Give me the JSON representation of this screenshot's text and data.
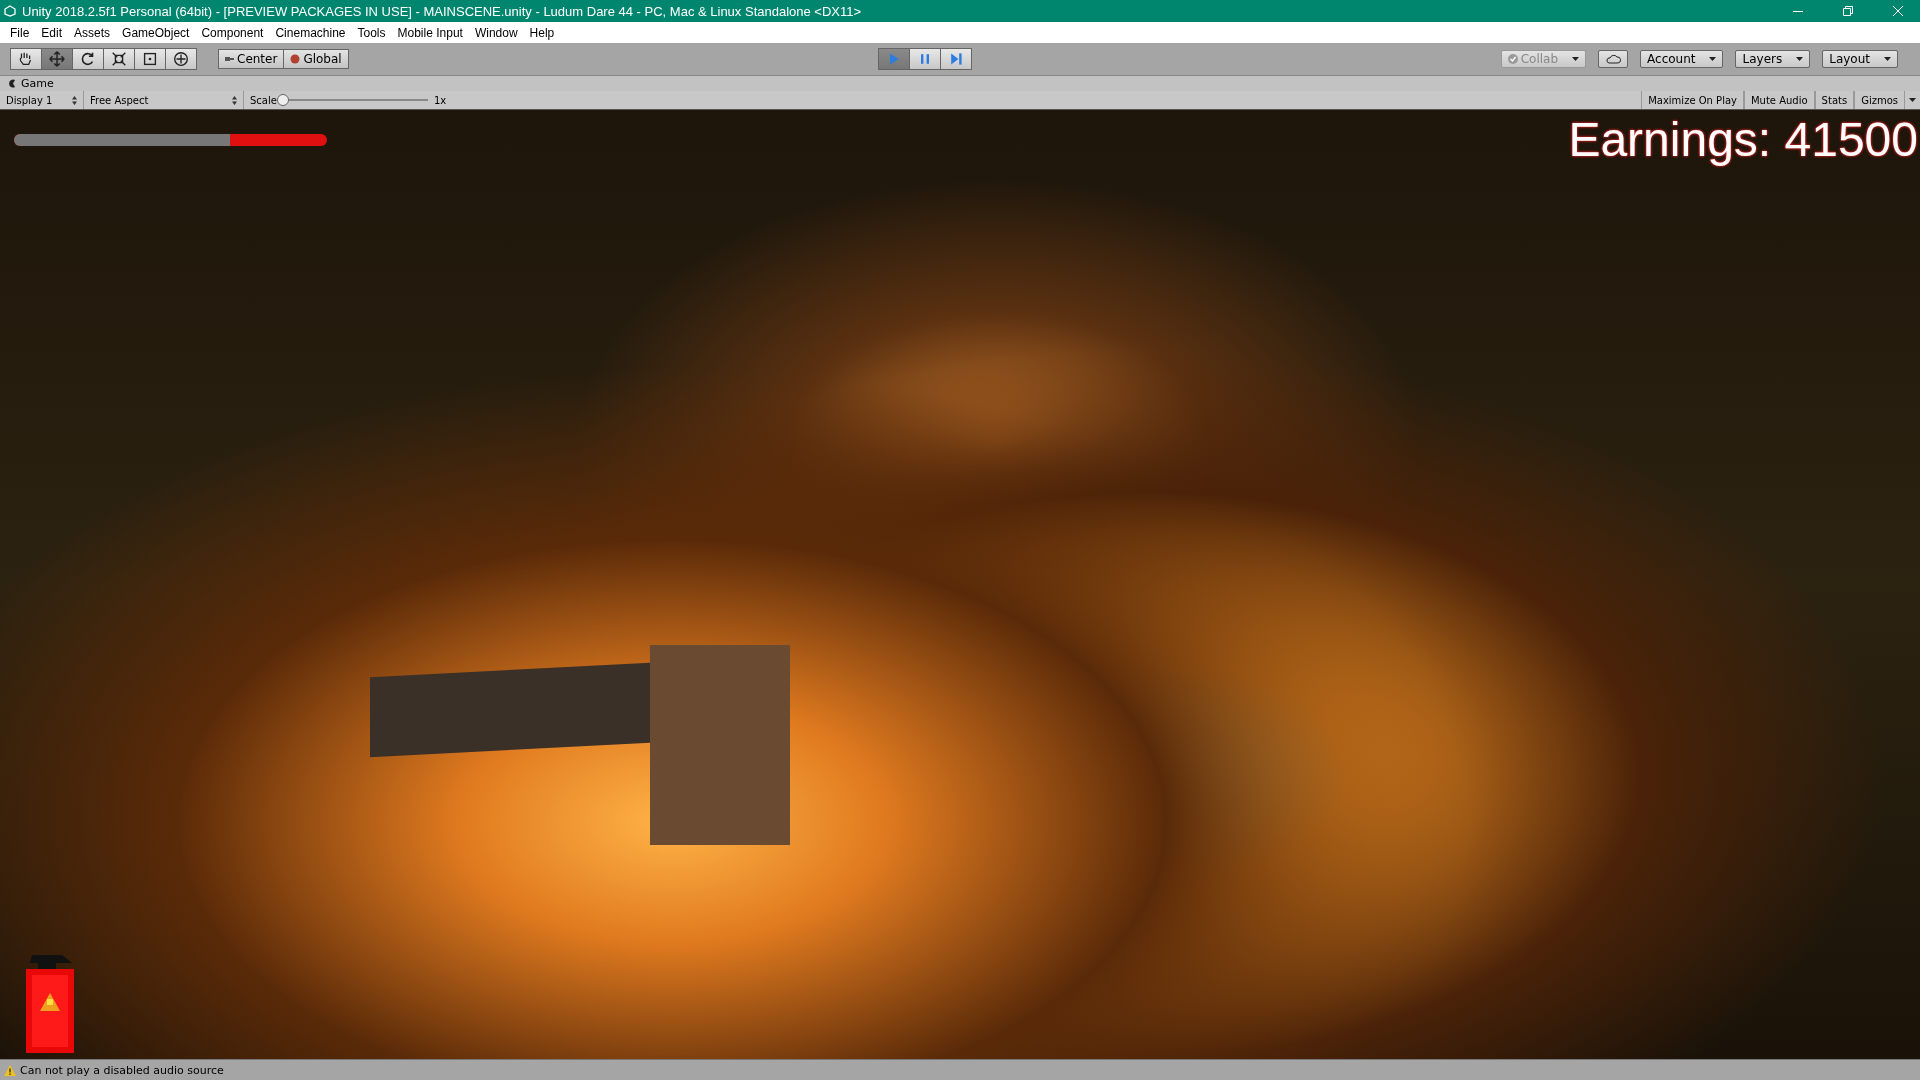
{
  "window": {
    "title": "Unity 2018.2.5f1 Personal (64bit) - [PREVIEW PACKAGES IN USE] - MAINSCENE.unity - Ludum Dare 44 - PC, Mac & Linux Standalone <DX11>"
  },
  "menu": [
    "File",
    "Edit",
    "Assets",
    "GameObject",
    "Component",
    "Cinemachine",
    "Tools",
    "Mobile Input",
    "Window",
    "Help"
  ],
  "toolbar": {
    "tools": [
      {
        "kind": "hand",
        "selected": false
      },
      {
        "kind": "move",
        "selected": true
      },
      {
        "kind": "rotate",
        "selected": false
      },
      {
        "kind": "scale",
        "selected": false
      },
      {
        "kind": "rect",
        "selected": false
      },
      {
        "kind": "transform",
        "selected": false
      }
    ],
    "pivot": [
      "Center",
      "Global"
    ],
    "playback": [
      {
        "kind": "play",
        "on": true
      },
      {
        "kind": "pause",
        "on": false
      },
      {
        "kind": "step",
        "on": false
      }
    ],
    "collab": {
      "label": "Collab",
      "disabled": true
    },
    "dropdowns": [
      "Account",
      "Layers",
      "Layout"
    ]
  },
  "game_panel": {
    "tab": "Game",
    "display": "Display 1",
    "aspect": "Free Aspect",
    "scale_label": "Scale",
    "scale": {
      "level": 0.0
    },
    "scale_reading": "1x",
    "toggles": [
      {
        "label": "Maximize On Play",
        "on": false
      },
      {
        "label": "Mute Audio",
        "on": false
      },
      {
        "label": "Stats",
        "on": false
      },
      {
        "label": "Gizmos",
        "on": false
      }
    ]
  },
  "hud": {
    "health": {
      "level": 0.69
    },
    "earnings": "Earnings: 41500"
  },
  "status_bar": {
    "message": "Can not play a disabled audio source"
  }
}
